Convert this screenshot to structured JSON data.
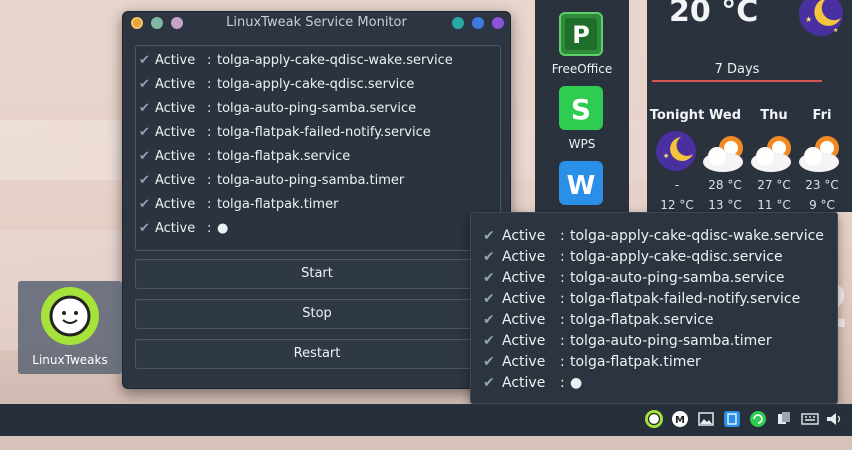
{
  "window": {
    "title": "LinuxTweak Service Monitor",
    "services": [
      {
        "status": "Active",
        "sep": ":",
        "name": "tolga-apply-cake-qdisc-wake.service"
      },
      {
        "status": "Active",
        "sep": ":",
        "name": "tolga-apply-cake-qdisc.service"
      },
      {
        "status": "Active",
        "sep": ":",
        "name": "tolga-auto-ping-samba.service"
      },
      {
        "status": "Active",
        "sep": ":",
        "name": "tolga-flatpak-failed-notify.service"
      },
      {
        "status": "Active",
        "sep": ":",
        "name": "tolga-flatpak.service"
      },
      {
        "status": "Active",
        "sep": ":",
        "name": "tolga-auto-ping-samba.timer"
      },
      {
        "status": "Active",
        "sep": ":",
        "name": "tolga-flatpak.timer"
      },
      {
        "status": "Active",
        "sep": ":",
        "name": "●"
      }
    ],
    "buttons": {
      "start": "Start",
      "stop": "Stop",
      "restart": "Restart"
    }
  },
  "dock": {
    "apps": [
      {
        "label": "FreeOffice",
        "icon": "freeoffice-icon"
      },
      {
        "label": "WPS",
        "icon": "wps-icon"
      },
      {
        "label": "",
        "icon": "wps-writer-icon"
      }
    ]
  },
  "weather": {
    "current_temp": "20 °C",
    "tab": "7 Days",
    "days": [
      {
        "name": "Tonight",
        "hi": "-",
        "lo": "12 °C"
      },
      {
        "name": "Wed",
        "hi": "28 °C",
        "lo": "13 °C"
      },
      {
        "name": "Thu",
        "hi": "27 °C",
        "lo": "11 °C"
      },
      {
        "name": "Fri",
        "hi": "23 °C",
        "lo": "9 °C"
      }
    ]
  },
  "desktop": {
    "icon_label": "LinuxTweaks"
  },
  "tooltip": {
    "services": [
      {
        "status": "Active",
        "sep": ":",
        "name": "tolga-apply-cake-qdisc-wake.service"
      },
      {
        "status": "Active",
        "sep": ":",
        "name": "tolga-apply-cake-qdisc.service"
      },
      {
        "status": "Active",
        "sep": ":",
        "name": "tolga-auto-ping-samba.service"
      },
      {
        "status": "Active",
        "sep": ":",
        "name": "tolga-flatpak-failed-notify.service"
      },
      {
        "status": "Active",
        "sep": ":",
        "name": "tolga-flatpak.service"
      },
      {
        "status": "Active",
        "sep": ":",
        "name": "tolga-auto-ping-samba.timer"
      },
      {
        "status": "Active",
        "sep": ":",
        "name": "tolga-flatpak.timer"
      },
      {
        "status": "Active",
        "sep": ":",
        "name": "●"
      }
    ]
  },
  "colors": {
    "accent_red": "#d9534f",
    "window_bg": "#2c3541",
    "lime": "#a5e23a"
  }
}
